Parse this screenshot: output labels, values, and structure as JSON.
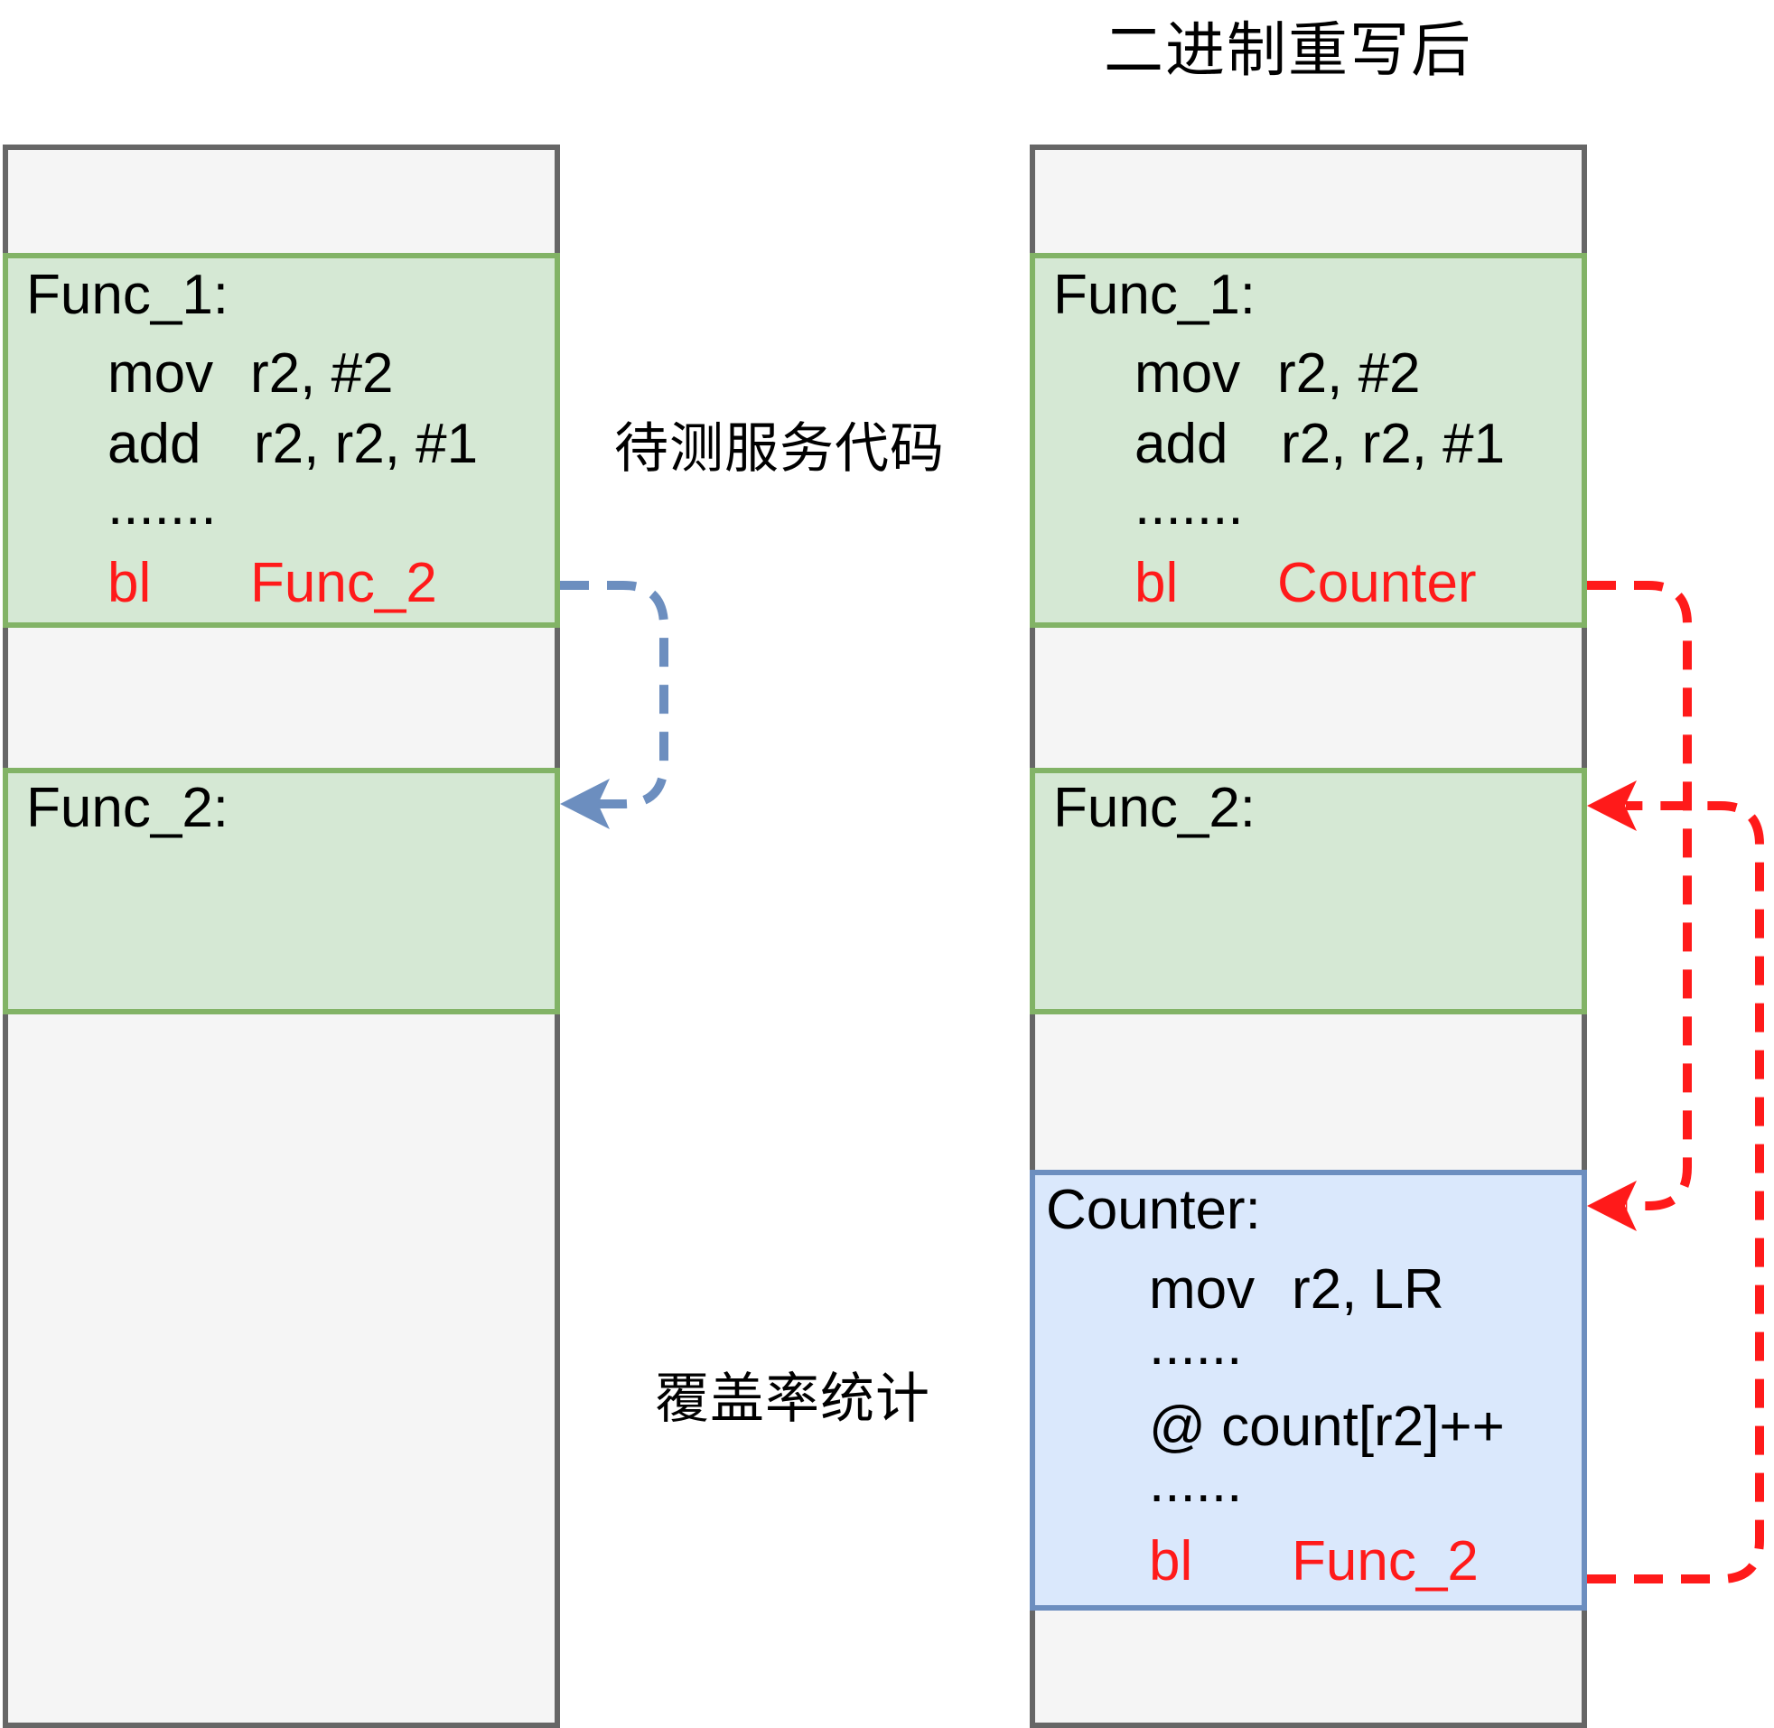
{
  "title": "二进制重写后",
  "captions": {
    "service_code": "待测服务代码",
    "coverage": "覆盖率统计"
  },
  "left": {
    "func1": {
      "label": "Func_1:",
      "instructions": [
        {
          "op": "mov",
          "args": "r2, #2"
        },
        {
          "op": "add",
          "args": "r2, r2, #1"
        },
        {
          "op": "",
          "args": "......."
        },
        {
          "op": "bl",
          "args": "Func_2"
        }
      ]
    },
    "func2": {
      "label": "Func_2:"
    }
  },
  "right": {
    "func1": {
      "label": "Func_1:",
      "instructions": [
        {
          "op": "mov",
          "args": "r2, #2"
        },
        {
          "op": "add",
          "args": "r2, r2, #1"
        },
        {
          "op": "",
          "args": "......."
        },
        {
          "op": "bl",
          "args": "Counter"
        }
      ]
    },
    "func2": {
      "label": "Func_2:"
    },
    "counter": {
      "label": "Counter:",
      "instructions": [
        {
          "op": "mov",
          "args": "r2, LR"
        },
        {
          "op": "",
          "args": "......"
        },
        {
          "op": "",
          "args": "@ count[r2]++"
        },
        {
          "op": "",
          "args": "......"
        },
        {
          "op": "bl",
          "args": "Func_2"
        }
      ]
    }
  },
  "colors": {
    "memory_fill": "#f5f5f5",
    "memory_border": "#666666",
    "func_fill": "#d5e8d4",
    "func_border": "#82b366",
    "counter_fill": "#dae8fc",
    "counter_border": "#6c8ebf",
    "branch_red": "#ff1a1a",
    "arrow_blue": "#6c8ebf"
  }
}
